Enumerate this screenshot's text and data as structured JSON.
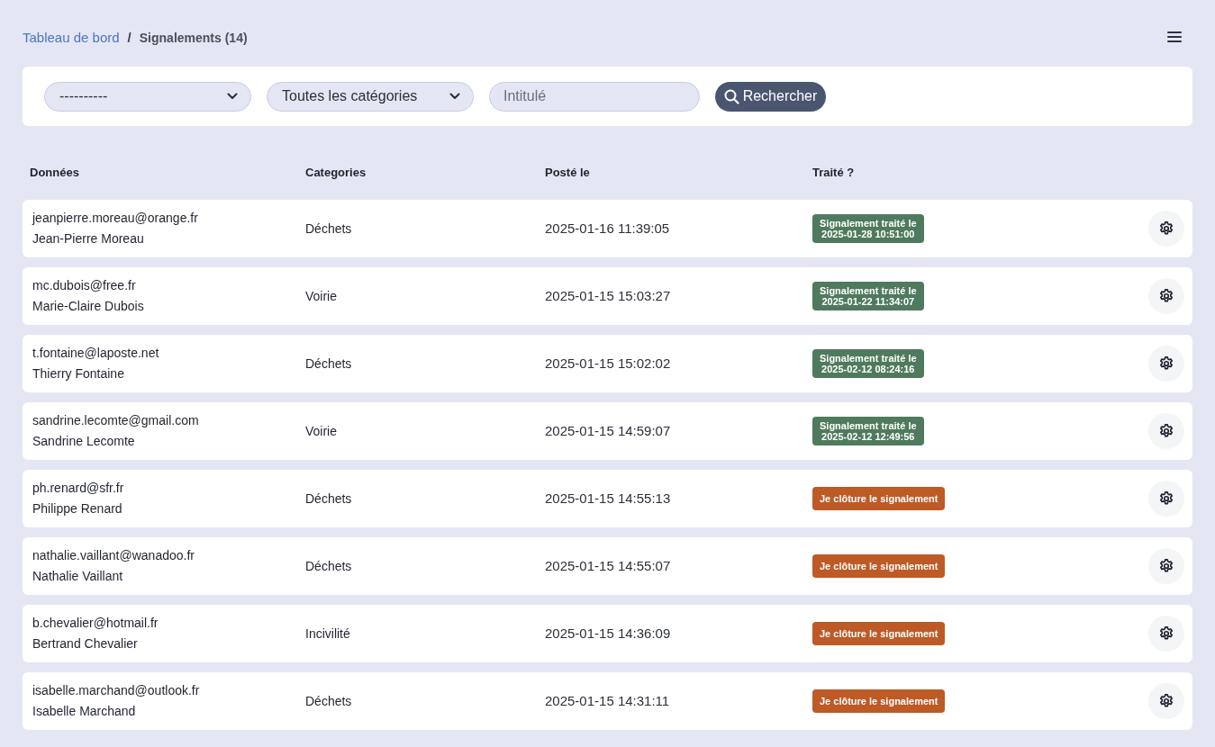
{
  "breadcrumb": {
    "link": "Tableau de bord",
    "separator": "/",
    "current": "Signalements (14)"
  },
  "filters": {
    "selects": [
      {
        "value": "----------"
      },
      {
        "value": "Toutes les catégories"
      }
    ],
    "search": {
      "placeholder": "Intitulé"
    },
    "button": "Rechercher"
  },
  "table": {
    "columns": [
      "Données",
      "Categories",
      "Posté le",
      "Traité ?"
    ],
    "rows": [
      {
        "email": "jeanpierre.moreau@orange.fr",
        "name": "Jean-Pierre Moreau",
        "category": "Déchets",
        "posted": "2025-01-16 11:39:05",
        "status": {
          "kind": "treated",
          "label": "Signalement traité le",
          "date": "2025-01-28 10:51:00"
        }
      },
      {
        "email": "mc.dubois@free.fr",
        "name": "Marie-Claire Dubois",
        "category": "Voirie",
        "posted": "2025-01-15 15:03:27",
        "status": {
          "kind": "treated",
          "label": "Signalement traité le",
          "date": "2025-01-22 11:34:07"
        }
      },
      {
        "email": "t.fontaine@laposte.net",
        "name": "Thierry Fontaine",
        "category": "Déchets",
        "posted": "2025-01-15 15:02:02",
        "status": {
          "kind": "treated",
          "label": "Signalement traité le",
          "date": "2025-02-12 08:24:16"
        }
      },
      {
        "email": "sandrine.lecomte@gmail.com",
        "name": "Sandrine Lecomte",
        "category": "Voirie",
        "posted": "2025-01-15 14:59:07",
        "status": {
          "kind": "treated",
          "label": "Signalement traité le",
          "date": "2025-02-12 12:49:56"
        }
      },
      {
        "email": "ph.renard@sfr.fr",
        "name": "Philippe Renard",
        "category": "Déchets",
        "posted": "2025-01-15 14:55:13",
        "status": {
          "kind": "open",
          "label": "Je clôture le signalement"
        }
      },
      {
        "email": "nathalie.vaillant@wanadoo.fr",
        "name": "Nathalie Vaillant",
        "category": "Déchets",
        "posted": "2025-01-15 14:55:07",
        "status": {
          "kind": "open",
          "label": "Je clôture le signalement"
        }
      },
      {
        "email": "b.chevalier@hotmail.fr",
        "name": "Bertrand Chevalier",
        "category": "Incivilité",
        "posted": "2025-01-15 14:36:09",
        "status": {
          "kind": "open",
          "label": "Je clôture le signalement"
        }
      },
      {
        "email": "isabelle.marchand@outlook.fr",
        "name": "Isabelle Marchand",
        "category": "Déchets",
        "posted": "2025-01-15 14:31:11",
        "status": {
          "kind": "open",
          "label": "Je clôture le signalement"
        }
      }
    ]
  }
}
